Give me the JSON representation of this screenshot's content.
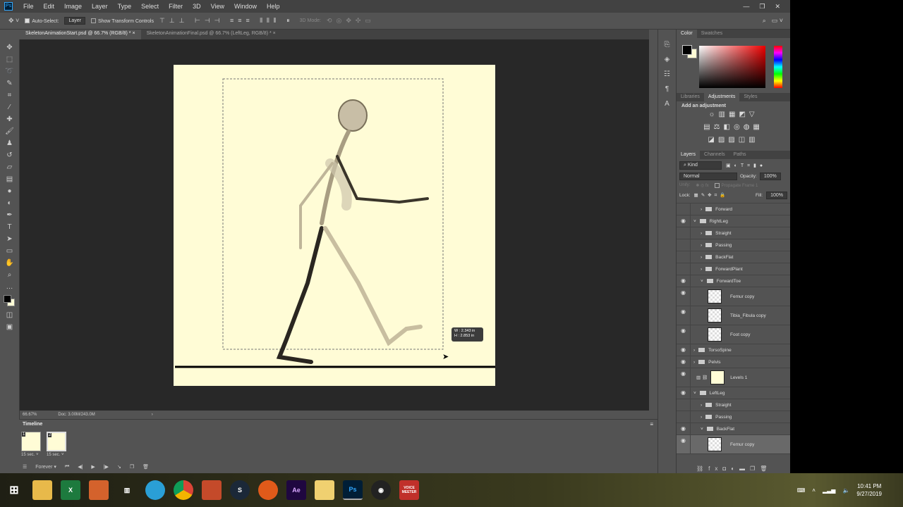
{
  "menu": {
    "logo": "Ps",
    "items": [
      "File",
      "Edit",
      "Image",
      "Layer",
      "Type",
      "Select",
      "Filter",
      "3D",
      "View",
      "Window",
      "Help"
    ]
  },
  "options": {
    "auto_select": "Auto-Select:",
    "target": "Layer",
    "show_transform": "Show Transform Controls",
    "mode_3d": "3D Mode:"
  },
  "tabs": [
    {
      "label": "SkeletonAnimationStart.psd @ 66.7% (RGB/8) *"
    },
    {
      "label": "SkeletonAnimationFinal.psd @ 66.7% (LeftLeg, RGB/8) *"
    }
  ],
  "canvas": {
    "readout_w": "W :  2.343 in",
    "readout_h": "H :  2.853 in"
  },
  "status": {
    "zoom": "66.67%",
    "doc": "Doc: 3.00M/243.0M"
  },
  "timeline": {
    "title": "Timeline",
    "frames": [
      {
        "num": "1",
        "duration": "15 sec."
      },
      {
        "num": "2",
        "duration": "15 sec."
      }
    ],
    "loop": "Forever"
  },
  "color_panel": {
    "tabs": [
      "Color",
      "Swatches"
    ],
    "fg": "#000000",
    "bg": "#fffcd6"
  },
  "adjustments_panel": {
    "tabs": [
      "Libraries",
      "Adjustments",
      "Styles"
    ],
    "heading": "Add an adjustment"
  },
  "layers_panel": {
    "tabs": [
      "Layers",
      "Channels",
      "Paths"
    ],
    "filter": "Kind",
    "blend": "Normal",
    "opacity_label": "Opacity:",
    "opacity": "100%",
    "unify": "Unify:",
    "propagate": "Propagate Frame 1",
    "lock": "Lock:",
    "fill_label": "Fill:",
    "fill": "100%",
    "layers": [
      {
        "name": "Forward",
        "visible": false,
        "type": "group",
        "indent": 2,
        "open": false
      },
      {
        "name": "RightLeg",
        "visible": true,
        "type": "group",
        "indent": 1,
        "open": true
      },
      {
        "name": "Straight",
        "visible": false,
        "type": "group",
        "indent": 2,
        "open": false
      },
      {
        "name": "Passing",
        "visible": false,
        "type": "group",
        "indent": 2,
        "open": false
      },
      {
        "name": "BackFlat",
        "visible": false,
        "type": "group",
        "indent": 2,
        "open": false
      },
      {
        "name": "ForwardPlant",
        "visible": false,
        "type": "group",
        "indent": 2,
        "open": false
      },
      {
        "name": "ForwardToe",
        "visible": true,
        "type": "group",
        "indent": 2,
        "open": true
      },
      {
        "name": "Femur copy",
        "visible": true,
        "type": "layer"
      },
      {
        "name": "Tibia_Fibula copy",
        "visible": true,
        "type": "layer"
      },
      {
        "name": "Foot copy",
        "visible": true,
        "type": "layer"
      },
      {
        "name": "TorsoSpine",
        "visible": true,
        "type": "group",
        "indent": 1,
        "open": false
      },
      {
        "name": "Pelvis",
        "visible": true,
        "type": "group",
        "indent": 1,
        "open": false
      },
      {
        "name": "Levels 1",
        "visible": true,
        "type": "adjustment"
      },
      {
        "name": "LeftLeg",
        "visible": true,
        "type": "group",
        "indent": 1,
        "open": true
      },
      {
        "name": "Straight",
        "visible": false,
        "type": "group",
        "indent": 2,
        "open": false
      },
      {
        "name": "Passing",
        "visible": false,
        "type": "group",
        "indent": 2,
        "open": false
      },
      {
        "name": "BackFlat",
        "visible": true,
        "type": "group",
        "indent": 2,
        "open": true
      },
      {
        "name": "Femur copy",
        "visible": true,
        "type": "layer",
        "selected": true
      }
    ]
  },
  "taskbar": {
    "time": "10:41 PM",
    "date": "9/27/2019",
    "apps": [
      "Ae",
      "Ps",
      "VOICE MEETER"
    ]
  }
}
